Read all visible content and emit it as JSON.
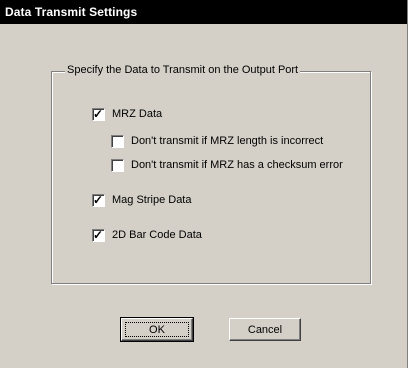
{
  "window": {
    "title": "Data Transmit Settings"
  },
  "group": {
    "label": "Specify the Data to Transmit on the Output Port"
  },
  "options": [
    {
      "label": "MRZ Data",
      "checked": true
    },
    {
      "label": "Don't transmit if MRZ length is incorrect",
      "checked": false
    },
    {
      "label": "Don't transmit if MRZ has a checksum error",
      "checked": false
    },
    {
      "label": "Mag Stripe Data",
      "checked": true
    },
    {
      "label": "2D Bar Code Data",
      "checked": true
    }
  ],
  "buttons": {
    "ok_label": "OK",
    "cancel_label": "Cancel"
  },
  "checkmark_glyph": "✓",
  "colors": {
    "window_background": "#d4d0c8",
    "title_background": "#000000",
    "title_text": "#ffffff"
  }
}
